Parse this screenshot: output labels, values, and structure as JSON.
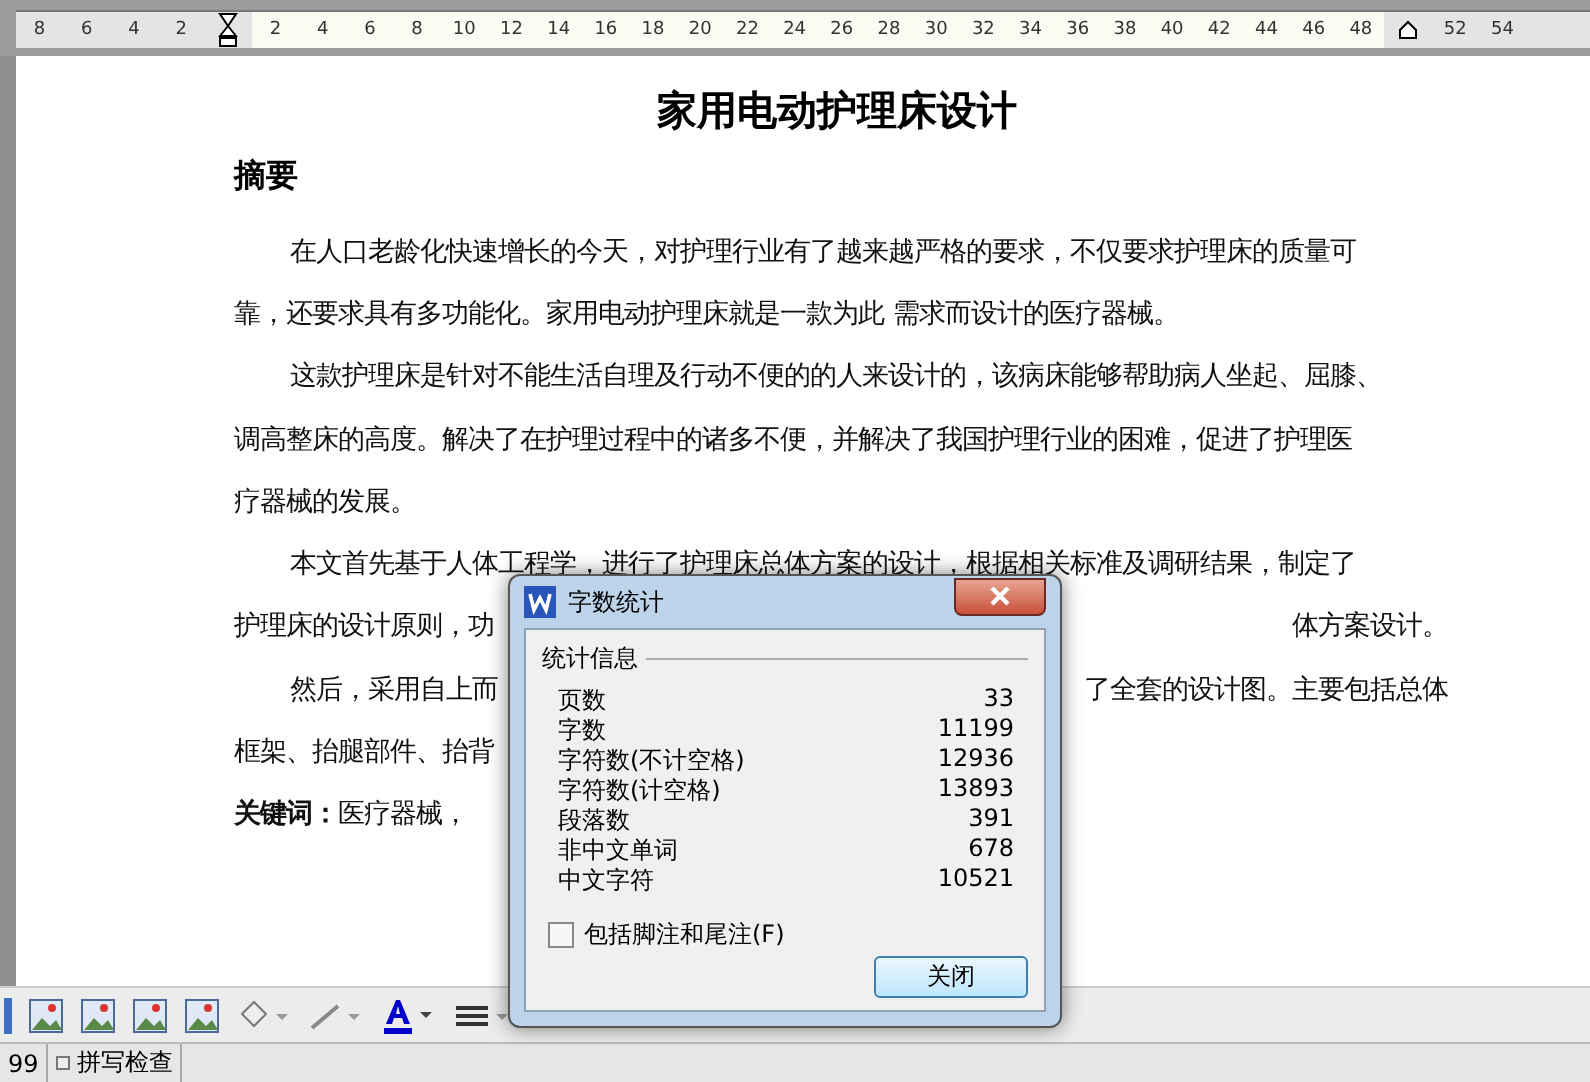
{
  "ruler": [
    {
      "kind": "number",
      "label": "8"
    },
    {
      "kind": "number",
      "label": "6"
    },
    {
      "kind": "number",
      "label": "4"
    },
    {
      "kind": "number",
      "label": "2"
    },
    {
      "kind": "left-marker"
    },
    {
      "kind": "number",
      "label": "2"
    },
    {
      "kind": "number",
      "label": "4"
    },
    {
      "kind": "number",
      "label": "6"
    },
    {
      "kind": "number",
      "label": "8"
    },
    {
      "kind": "number",
      "label": "10"
    },
    {
      "kind": "number",
      "label": "12"
    },
    {
      "kind": "number",
      "label": "14"
    },
    {
      "kind": "number",
      "label": "16"
    },
    {
      "kind": "number",
      "label": "18"
    },
    {
      "kind": "number",
      "label": "20"
    },
    {
      "kind": "number",
      "label": "22"
    },
    {
      "kind": "number",
      "label": "24"
    },
    {
      "kind": "number",
      "label": "26"
    },
    {
      "kind": "number",
      "label": "28"
    },
    {
      "kind": "number",
      "label": "30"
    },
    {
      "kind": "number",
      "label": "32"
    },
    {
      "kind": "number",
      "label": "34"
    },
    {
      "kind": "number",
      "label": "36"
    },
    {
      "kind": "number",
      "label": "38"
    },
    {
      "kind": "number",
      "label": "40"
    },
    {
      "kind": "number",
      "label": "42"
    },
    {
      "kind": "number",
      "label": "44"
    },
    {
      "kind": "number",
      "label": "46"
    },
    {
      "kind": "number",
      "label": "48"
    },
    {
      "kind": "right-marker"
    },
    {
      "kind": "number",
      "label": "52"
    },
    {
      "kind": "number",
      "label": "54"
    }
  ],
  "document": {
    "title": "家用电动护理床设计",
    "heading": "摘要",
    "paragraphs": [
      {
        "lines": [
          {
            "text": "在人口老龄化快速增长的今天，对护理行业有了越来越严格的要求，不仅要求护理床的质量可",
            "indent": true
          },
          {
            "text": "靠，还要求具有多功能化。家用电动护理床就是一款为此 需求而设计的医疗器械。"
          }
        ]
      },
      {
        "lines": [
          {
            "text": "这款护理床是针对不能生活自理及行动不便的的人来设计的，该病床能够帮助病人坐起、屈膝、",
            "indent": true
          },
          {
            "text": "调高整床的高度。解决了在护理过程中的诸多不便，并解决了我国护理行业的困难，促进了护理医"
          },
          {
            "text": "疗器械的发展。"
          }
        ]
      },
      {
        "lines": [
          {
            "text": " 本文首先基于人体工程学，进行了护理床总体方案的设计，根据相关标准及调研结果，制定了",
            "indent": true
          },
          {
            "text": "护理床的设计原则，功",
            "right": "体方案设计。"
          }
        ]
      },
      {
        "lines": [
          {
            "text": "然后，采用自上而",
            "right": "了全套的设计图。主要包括总体",
            "indent": true
          },
          {
            "text": "框架、抬腿部件、抬背"
          }
        ]
      },
      {
        "lines": [
          {
            "text": "**关键词：**医疗器械，"
          }
        ]
      }
    ]
  },
  "status_bar": {
    "page_count": "99",
    "spell_check": "拼写检查"
  },
  "dialog": {
    "title": "字数统计",
    "group": "统计信息",
    "stats": [
      {
        "label": "页数",
        "value": "33"
      },
      {
        "label": "字数",
        "value": "11199"
      },
      {
        "label": "字符数(不计空格)",
        "value": "12936"
      },
      {
        "label": "字符数(计空格)",
        "value": "13893"
      },
      {
        "label": "段落数",
        "value": "391"
      },
      {
        "label": "非中文单词",
        "value": "678"
      },
      {
        "label": "中文字符",
        "value": "10521"
      }
    ],
    "include_footnotes": {
      "label": "包括脚注和尾注(F)",
      "checked": false
    },
    "close_button": "关闭"
  }
}
